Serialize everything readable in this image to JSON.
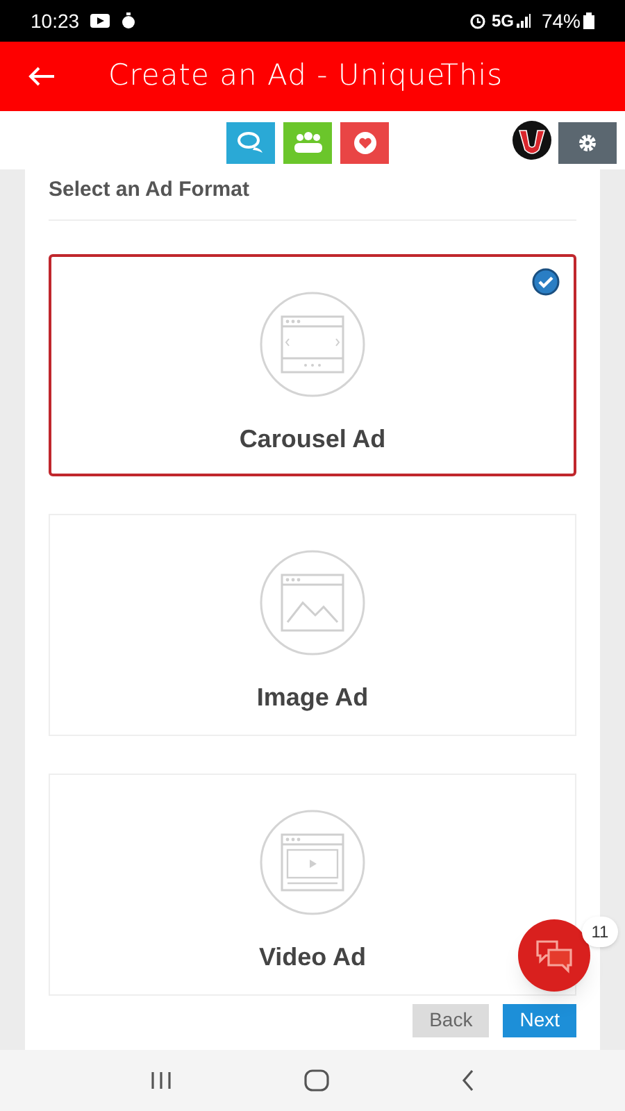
{
  "status_bar": {
    "time": "10:23",
    "network": "5G",
    "battery": "74%"
  },
  "header": {
    "title": "Create an Ad - UniqueThis"
  },
  "section": {
    "title": "Select an Ad Format"
  },
  "formats": [
    {
      "kind": "carousel",
      "label": "Carousel Ad",
      "selected": true
    },
    {
      "kind": "image",
      "label": "Image Ad",
      "selected": false
    },
    {
      "kind": "video",
      "label": "Video Ad",
      "selected": false
    }
  ],
  "buttons": {
    "back": "Back",
    "next": "Next"
  },
  "chat": {
    "badge": "11"
  }
}
